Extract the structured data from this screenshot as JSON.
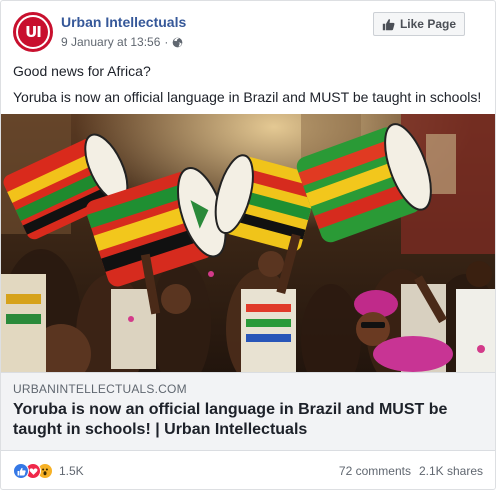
{
  "post": {
    "page_name": "Urban Intellectuals",
    "avatar_text": "UI",
    "timestamp": "9 January at 13:56",
    "separator": "·",
    "like_page_label": "Like Page",
    "text_line1": "Good news for Africa?",
    "text_line2": "Yoruba is now an official language in Brazil and MUST be taught in schools!"
  },
  "link": {
    "domain": "URBANINTELLECTUALS.COM",
    "title": "Yoruba is now an official language in Brazil and MUST be taught in schools! | Urban Intellectuals"
  },
  "footer": {
    "reaction_count": "1.5K",
    "comments": "72 comments",
    "shares": "2.1K shares"
  },
  "colors": {
    "brand_red": "#c8102e",
    "link_blue": "#365899",
    "like_blue": "#3578e5",
    "love_red": "#f0284a",
    "wow_yellow": "#f7b125"
  },
  "icons": [
    "globe-icon",
    "thumbs-up-icon",
    "like-reaction-icon",
    "love-reaction-icon",
    "wow-reaction-icon"
  ]
}
